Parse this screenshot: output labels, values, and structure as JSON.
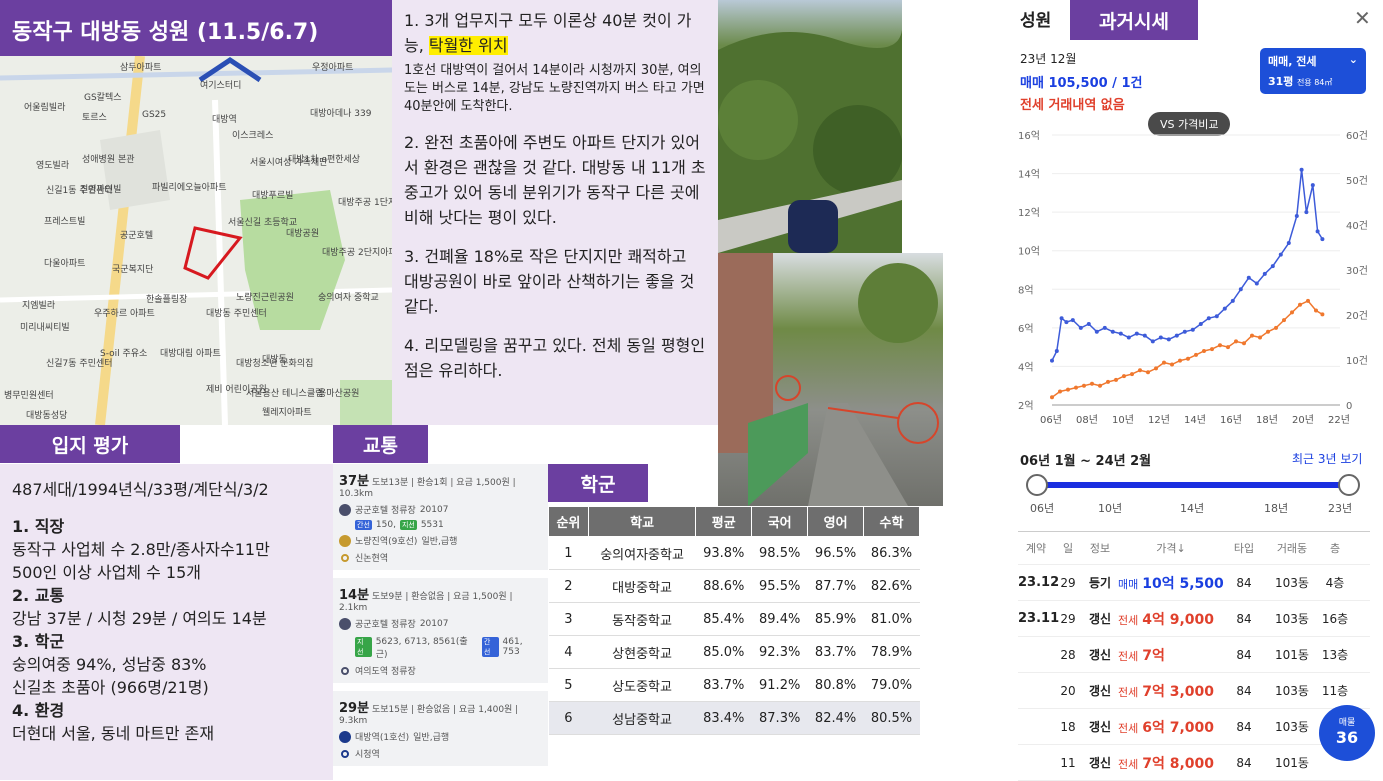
{
  "map": {
    "title": "동작구 대방동 성원 (11.5/6.7)",
    "labels": [
      "삼두아파트",
      "우정아파트",
      "여기스터디",
      "GS칼텍스",
      "어울림빌라",
      "토르스",
      "GS25",
      "대방역",
      "대방아데나 339",
      "이스크레스",
      "영도빌라",
      "성애병원 본관",
      "신길1동 주민센터",
      "진영파인빌",
      "파빌리에오늘아파트",
      "서울시여성 가족재단",
      "대방1차 e편한세상",
      "대방푸르빌",
      "프레스트빌",
      "다울아파트",
      "서울신길 초등학교",
      "공군호텔",
      "대방주공 1단지아파트",
      "대방공원",
      "국군복지단",
      "대방주공 2단지아파트",
      "지엠빌라",
      "한솔플링장",
      "노량진근린공원",
      "숭의여자 중학교",
      "미리내씨티빌",
      "우주하르 아파트",
      "대방동 주민센터",
      "대방대림 아파트",
      "신길7동 주민센터",
      "S-oil 주유소",
      "대방청소년 문화의집",
      "대방동",
      "병무민원센터",
      "제비 어린이공원",
      "서울용산 테니스클럽",
      "용마산공원",
      "대방동성당",
      "웰레지아파트"
    ]
  },
  "notes": {
    "p1_title": "1. 3개 업무지구 모두 이론상 40분 컷이 가능,",
    "p1_highlight": "탁월한 위치",
    "p1_detail": "1호선 대방역이 걸어서 14분이라 시청까지 30분, 여의도는 버스로 14분, 강남도 노량진역까지 버스 타고 가면 40분안에 도착한다.",
    "p2": "2. 완전 초품아에 주변도 아파트 단지가 있어서 환경은 괜찮을 것 같다. 대방동 내 11개 초중고가 있어 동네 분위기가 동작구 다른 곳에 비해 낫다는 평이 있다.",
    "p3": "3. 건폐율 18%로 작은 단지지만 쾌적하고 대방공원이 바로 앞이라 산책하기는 좋을 것 같다.",
    "p4": "4. 리모델링을 꿈꾸고 있다. 전체 동일 평형인 점은 유리하다."
  },
  "eval": {
    "header": "입지 평가",
    "summary": "487세대/1994년식/33평/계단식/3/2",
    "h1": "1. 직장",
    "l1a": "동작구 사업체 수 2.8만/종사자수11만",
    "l1b": "500인 이상 사업체 수 15개",
    "h2": "2. 교통",
    "l2": "강남 37분 / 시청 29분 / 여의도 14분",
    "h3": "3. 학군",
    "l3a": "숭의여중 94%, 성남중 83%",
    "l3b": "신길초 초품아 (966명/21명)",
    "h4": "4. 환경",
    "l4": "더현대 서울, 동네 마트만 존재"
  },
  "traffic": {
    "header": "교통",
    "routes": [
      {
        "time": "37분",
        "meta": "도보13분 | 환승1회 | 요금 1,500원 | 10.3km",
        "s1": "공군호텔 정류장",
        "s1code": "20107",
        "bus_tag": "간선",
        "bus_num": "150,",
        "bus_tag2": "지선",
        "bus_num2": "5531",
        "s2": "노량진역(9호선)",
        "s2sub": "일반,급행",
        "s3": "신논현역"
      },
      {
        "time": "14분",
        "meta": "도보9분 | 환승없음 | 요금 1,500원 | 2.1km",
        "s1": "공군호텔 정류장",
        "s1code": "20107",
        "bus_tag": "지선",
        "bus_num": "5623, 6713, 8561(출근)",
        "bus_tag2": "간선",
        "bus_num2": "461, 753",
        "s2": "여의도역 정류장"
      },
      {
        "time": "29분",
        "meta": "도보15분 | 환승없음 | 요금 1,400원 | 9.3km",
        "s1": "대방역(1호선)",
        "s1sub": "일반,급행",
        "s2": "시청역"
      }
    ]
  },
  "school": {
    "header": "학군",
    "columns": [
      "순위",
      "학교",
      "평균",
      "국어",
      "영어",
      "수학"
    ],
    "rows": [
      [
        "1",
        "숭의여자중학교",
        "93.8%",
        "98.5%",
        "96.5%",
        "86.3%"
      ],
      [
        "2",
        "대방중학교",
        "88.6%",
        "95.5%",
        "87.7%",
        "82.6%"
      ],
      [
        "3",
        "동작중학교",
        "85.4%",
        "89.4%",
        "85.9%",
        "81.0%"
      ],
      [
        "4",
        "상현중학교",
        "85.0%",
        "92.3%",
        "83.7%",
        "78.9%"
      ],
      [
        "5",
        "상도중학교",
        "83.7%",
        "91.2%",
        "80.8%",
        "79.0%"
      ],
      [
        "6",
        "성남중학교",
        "83.4%",
        "87.3%",
        "82.4%",
        "80.5%"
      ]
    ]
  },
  "panel": {
    "name": "성원",
    "tab": "과거시세",
    "close": "✕",
    "date": "23년 12월",
    "sale": "매매 105,500 / 1건",
    "jeonse": "전세 거래내역 없음",
    "filter_type": "매매, 전세",
    "filter_size": "31평",
    "filter_area": "전용 84㎡",
    "compare": "VS 가격비교",
    "range_label": "06년 1월 ~ 24년 2월",
    "recent": "최근 3년 보기",
    "slider_ticks": [
      "06년",
      "10년",
      "14년",
      "18년",
      "23년"
    ],
    "tx_headers": [
      "계약",
      "일",
      "정보",
      "가격↓",
      "타입",
      "거래동",
      "층"
    ],
    "tx_rows": [
      {
        "ym": "23.12",
        "d": "29",
        "info": "등기",
        "kind": "매매",
        "price": "10억 5,500",
        "type": "84",
        "dong": "103동",
        "floor": "4층"
      },
      {
        "ym": "23.11",
        "d": "29",
        "info": "갱신",
        "kind": "전세",
        "price": "4억 9,000",
        "type": "84",
        "dong": "103동",
        "floor": "16층"
      },
      {
        "ym": "",
        "d": "28",
        "info": "갱신",
        "kind": "전세",
        "price": "7억",
        "type": "84",
        "dong": "101동",
        "floor": "13층"
      },
      {
        "ym": "",
        "d": "20",
        "info": "갱신",
        "kind": "전세",
        "price": "7억 3,000",
        "type": "84",
        "dong": "103동",
        "floor": "11층"
      },
      {
        "ym": "",
        "d": "18",
        "info": "갱신",
        "kind": "전세",
        "price": "6억 7,000",
        "type": "84",
        "dong": "103동",
        "floor": ""
      },
      {
        "ym": "",
        "d": "11",
        "info": "갱신",
        "kind": "전세",
        "price": "7억 8,000",
        "type": "84",
        "dong": "101동",
        "floor": ""
      }
    ],
    "fab_label": "매물",
    "fab_count": "36"
  },
  "chart_data": {
    "type": "line",
    "x_ticks": [
      "06년",
      "08년",
      "10년",
      "12년",
      "14년",
      "16년",
      "18년",
      "20년",
      "22년"
    ],
    "y_left_ticks": [
      "2억",
      "4억",
      "6억",
      "8억",
      "10억",
      "12억",
      "14억",
      "16억"
    ],
    "y_right_ticks": [
      "0",
      "10건",
      "20건",
      "30건",
      "40건",
      "50건",
      "60건"
    ],
    "y_left_range": [
      2,
      16
    ],
    "y_right_range": [
      0,
      60
    ],
    "x_range": [
      2006,
      2024
    ],
    "series": [
      {
        "color": "#3d5bd9",
        "values": [
          [
            2006.0,
            4.3
          ],
          [
            2006.3,
            4.8
          ],
          [
            2006.6,
            6.5
          ],
          [
            2006.9,
            6.3
          ],
          [
            2007.3,
            6.4
          ],
          [
            2007.8,
            6.0
          ],
          [
            2008.3,
            6.2
          ],
          [
            2008.8,
            5.8
          ],
          [
            2009.3,
            6.0
          ],
          [
            2009.8,
            5.8
          ],
          [
            2010.3,
            5.7
          ],
          [
            2010.8,
            5.5
          ],
          [
            2011.3,
            5.7
          ],
          [
            2011.8,
            5.6
          ],
          [
            2012.3,
            5.3
          ],
          [
            2012.8,
            5.5
          ],
          [
            2013.3,
            5.4
          ],
          [
            2013.8,
            5.6
          ],
          [
            2014.3,
            5.8
          ],
          [
            2014.8,
            5.9
          ],
          [
            2015.3,
            6.2
          ],
          [
            2015.8,
            6.5
          ],
          [
            2016.3,
            6.6
          ],
          [
            2016.8,
            7.0
          ],
          [
            2017.3,
            7.4
          ],
          [
            2017.8,
            8.0
          ],
          [
            2018.3,
            8.6
          ],
          [
            2018.8,
            8.3
          ],
          [
            2019.3,
            8.8
          ],
          [
            2019.8,
            9.2
          ],
          [
            2020.3,
            9.8
          ],
          [
            2020.8,
            10.4
          ],
          [
            2021.3,
            11.8
          ],
          [
            2021.6,
            14.2
          ],
          [
            2021.9,
            12.0
          ],
          [
            2022.3,
            13.4
          ],
          [
            2022.6,
            11.0
          ],
          [
            2022.9,
            10.6
          ]
        ]
      },
      {
        "color": "#f0782e",
        "values": [
          [
            2006.0,
            2.4
          ],
          [
            2006.5,
            2.7
          ],
          [
            2007.0,
            2.8
          ],
          [
            2007.5,
            2.9
          ],
          [
            2008.0,
            3.0
          ],
          [
            2008.5,
            3.1
          ],
          [
            2009.0,
            3.0
          ],
          [
            2009.5,
            3.2
          ],
          [
            2010.0,
            3.3
          ],
          [
            2010.5,
            3.5
          ],
          [
            2011.0,
            3.6
          ],
          [
            2011.5,
            3.8
          ],
          [
            2012.0,
            3.7
          ],
          [
            2012.5,
            3.9
          ],
          [
            2013.0,
            4.2
          ],
          [
            2013.5,
            4.1
          ],
          [
            2014.0,
            4.3
          ],
          [
            2014.5,
            4.4
          ],
          [
            2015.0,
            4.6
          ],
          [
            2015.5,
            4.8
          ],
          [
            2016.0,
            4.9
          ],
          [
            2016.5,
            5.1
          ],
          [
            2017.0,
            5.0
          ],
          [
            2017.5,
            5.3
          ],
          [
            2018.0,
            5.2
          ],
          [
            2018.5,
            5.6
          ],
          [
            2019.0,
            5.5
          ],
          [
            2019.5,
            5.8
          ],
          [
            2020.0,
            6.0
          ],
          [
            2020.5,
            6.4
          ],
          [
            2021.0,
            6.8
          ],
          [
            2021.5,
            7.2
          ],
          [
            2022.0,
            7.4
          ],
          [
            2022.5,
            6.9
          ],
          [
            2022.9,
            6.7
          ]
        ]
      }
    ]
  }
}
